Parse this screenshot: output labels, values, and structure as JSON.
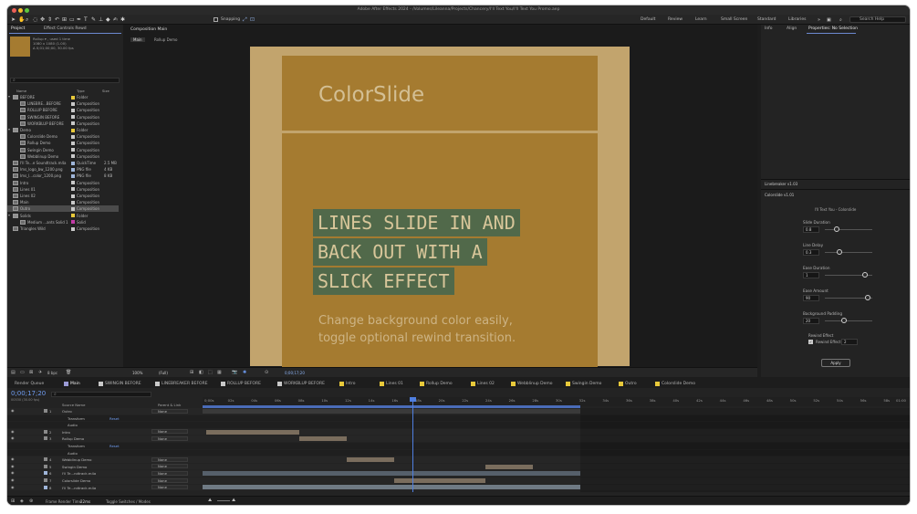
{
  "window": {
    "title": "Adobe After Effects 2024 - /Volumes/Lileanna/Projects/Chancery/I'll Text You/I'll Text You Promo.aep"
  },
  "toolbar": {
    "snapping_label": "Snapping",
    "workspaces": [
      "Default",
      "Review",
      "Learn",
      "Small Screen",
      "Standard",
      "Libraries"
    ],
    "search_placeholder": "Search Help"
  },
  "project_panel": {
    "tabs": [
      "Project",
      "Effect Controls Rewd"
    ],
    "selected_info": [
      "Rollup ▾ , used 1 time",
      "1080 x 1080 (1.00)",
      "Δ 0;01;00;00, 30.00 fps"
    ],
    "columns": [
      "Name",
      "Type",
      "Size"
    ],
    "items": [
      {
        "indent": 0,
        "name": "BEFORE",
        "color": "#e8c93a",
        "type": "Folder",
        "size": "",
        "folder": true
      },
      {
        "indent": 1,
        "name": "LINEBRE...BEFORE",
        "color": "#c9c9c9",
        "type": "Composition",
        "size": ""
      },
      {
        "indent": 1,
        "name": "ROLLUP BEFORE",
        "color": "#c9c9c9",
        "type": "Composition",
        "size": ""
      },
      {
        "indent": 1,
        "name": "SWINGIN BEFORE",
        "color": "#c9c9c9",
        "type": "Composition",
        "size": ""
      },
      {
        "indent": 1,
        "name": "WORKBLUP BEFORE",
        "color": "#c9c9c9",
        "type": "Composition",
        "size": ""
      },
      {
        "indent": 0,
        "name": "Demo",
        "color": "#e8c93a",
        "type": "Folder",
        "size": "",
        "folder": true
      },
      {
        "indent": 1,
        "name": "Colorslide Demo",
        "color": "#c9c9c9",
        "type": "Composition",
        "size": ""
      },
      {
        "indent": 1,
        "name": "Rollup Demo",
        "color": "#c9c9c9",
        "type": "Composition",
        "size": ""
      },
      {
        "indent": 1,
        "name": "Swingin Demo",
        "color": "#c9c9c9",
        "type": "Composition",
        "size": ""
      },
      {
        "indent": 1,
        "name": "Webblinup Demo",
        "color": "#c9c9c9",
        "type": "Composition",
        "size": ""
      },
      {
        "indent": 0,
        "name": "I'll Te...e Soundtrack.m4a",
        "color": "#9fb5d9",
        "type": "QuickTime",
        "size": "2.5 MB"
      },
      {
        "indent": 0,
        "name": "Ims_logo_bw_1200.png",
        "color": "#9fb5d9",
        "type": "PNG file",
        "size": "4 KB"
      },
      {
        "indent": 0,
        "name": "Ims_l...color_1200.png",
        "color": "#9fb5d9",
        "type": "PNG file",
        "size": "8 KB"
      },
      {
        "indent": 0,
        "name": "Intro",
        "color": "#c9c9c9",
        "type": "Composition",
        "size": ""
      },
      {
        "indent": 0,
        "name": "Lines 01",
        "color": "#c9c9c9",
        "type": "Composition",
        "size": ""
      },
      {
        "indent": 0,
        "name": "Lines 02",
        "color": "#c9c9c9",
        "type": "Composition",
        "size": ""
      },
      {
        "indent": 0,
        "name": "Main",
        "color": "#c9c9c9",
        "type": "Composition",
        "size": ""
      },
      {
        "indent": 0,
        "name": "Outro",
        "color": "#c9c9c9",
        "type": "Composition",
        "size": "",
        "selected": true
      },
      {
        "indent": 0,
        "name": "Solids",
        "color": "#e8c93a",
        "type": "Folder",
        "size": "",
        "folder": true
      },
      {
        "indent": 1,
        "name": "Medium ...ants Solid 1",
        "color": "#c23ba6",
        "type": "Solid",
        "size": ""
      },
      {
        "indent": 0,
        "name": "Triangles Wild",
        "color": "#c9c9c9",
        "type": "Composition",
        "size": ""
      }
    ],
    "footer": {
      "bpc": "8 bpc"
    }
  },
  "composition_panel": {
    "tab": "Composition Main",
    "breadcrumbs": [
      "Main",
      "Rollup Demo"
    ],
    "zoom": "100%",
    "resolution": "(Full)",
    "timecode": "0;00;17;20",
    "canvas": {
      "heading": "ColorSlide",
      "highlight_lines": [
        "LINES SLIDE IN AND",
        "BACK OUT WITH A",
        "SLICK EFFECT"
      ],
      "body_lines": [
        "Change background color easily,",
        "toggle optional rewind transition."
      ],
      "bg_outer": "#c2a46d",
      "bg_card": "#a57b30",
      "highlight_color": "#51694a",
      "text_light": "#d8c69a"
    }
  },
  "right_panel": {
    "tabs": [
      "Info",
      "Align",
      "Properties: No Selection"
    ],
    "section1": "Linebreaker v1.03",
    "section2": "Colorslide v1.01",
    "subtitle": "I'll Text You - Colorslide",
    "props": [
      {
        "label": "Slide Duration",
        "value": "0.8",
        "pos": 0.25
      },
      {
        "label": "Line Delay",
        "value": "0.3",
        "pos": 0.3
      },
      {
        "label": "Ease Duration",
        "value": "1",
        "pos": 0.85
      },
      {
        "label": "Ease Amount",
        "value": "90",
        "pos": 0.9
      },
      {
        "label": "Background Padding",
        "value": "20",
        "pos": 0.4
      }
    ],
    "rewind": {
      "label": "Rewind Effect",
      "checkbox_label": "Rewind Effect",
      "value": "2"
    },
    "apply": "Apply"
  },
  "timeline": {
    "tabs": [
      {
        "label": "Render Queue",
        "color": ""
      },
      {
        "label": "Main",
        "color": "#9b9bd6",
        "active": true
      },
      {
        "label": "SWINGIN BEFORE",
        "color": "#c9c9c9"
      },
      {
        "label": "LINEBREAKER BEFORE",
        "color": "#c9c9c9"
      },
      {
        "label": "ROLLUP BEFORE",
        "color": "#c9c9c9"
      },
      {
        "label": "WORKBLUP BEFORE",
        "color": "#c9c9c9"
      },
      {
        "label": "Intro",
        "color": "#e8c93a"
      },
      {
        "label": "Lines 01",
        "color": "#e8c93a"
      },
      {
        "label": "Rollup Demo",
        "color": "#e8c93a"
      },
      {
        "label": "Lines 02",
        "color": "#e8c93a"
      },
      {
        "label": "Webblinup Demo",
        "color": "#e8c93a"
      },
      {
        "label": "Swingin Demo",
        "color": "#e8c93a"
      },
      {
        "label": "Outro",
        "color": "#e8c93a"
      },
      {
        "label": "Colorslide Demo",
        "color": "#e8c93a"
      }
    ],
    "current_time": "0;00;17;20",
    "fps_info": "00530 (30.00 fps)",
    "col_source": "Source Name",
    "col_parent": "Parent & Link",
    "ruler": [
      "0;00s",
      "02s",
      "04s",
      "06s",
      "08s",
      "10s",
      "12s",
      "14s",
      "16s",
      "18s",
      "20s",
      "22s",
      "24s",
      "26s",
      "28s",
      "30s",
      "32s",
      "34s",
      "36s",
      "38s",
      "40s",
      "42s",
      "44s",
      "46s",
      "48s",
      "50s",
      "52s",
      "54s",
      "56s",
      "58s",
      "01:00"
    ],
    "layers": [
      {
        "num": "1",
        "name": "Outro",
        "parent": "None",
        "sub": false,
        "color": "#8a8a8a"
      },
      {
        "num": "",
        "name": "Transform",
        "parent": "",
        "sub": true,
        "reset": "Reset"
      },
      {
        "num": "",
        "name": "Audio",
        "parent": "",
        "sub": true
      },
      {
        "num": "2",
        "name": "Intro",
        "parent": "None",
        "sub": false,
        "color": "#8a8a8a"
      },
      {
        "num": "3",
        "name": "Rollup Demo",
        "parent": "None",
        "sub": false,
        "color": "#8a8a8a"
      },
      {
        "num": "",
        "name": "Transform",
        "parent": "",
        "sub": true,
        "reset": "Reset"
      },
      {
        "num": "",
        "name": "Audio",
        "parent": "",
        "sub": true
      },
      {
        "num": "4",
        "name": "Webblinup Demo",
        "parent": "None",
        "sub": false,
        "color": "#8a8a8a"
      },
      {
        "num": "5",
        "name": "Swingin Demo",
        "parent": "None",
        "sub": false,
        "color": "#8a8a8a"
      },
      {
        "num": "6",
        "name": "I'll Te...ndtrack.m4a",
        "parent": "None",
        "sub": false,
        "color": "#9fb5d9"
      },
      {
        "num": "7",
        "name": "Colorslide Demo",
        "parent": "None",
        "sub": false,
        "color": "#8a8a8a"
      },
      {
        "num": "8",
        "name": "I'll Te...ndtrack.m4a",
        "parent": "None",
        "sub": false,
        "color": "#9fb5d9"
      }
    ],
    "footer": {
      "render_label": "Frame Render Time",
      "render_value": "22ms",
      "toggle": "Toggle Switches / Modes"
    }
  }
}
